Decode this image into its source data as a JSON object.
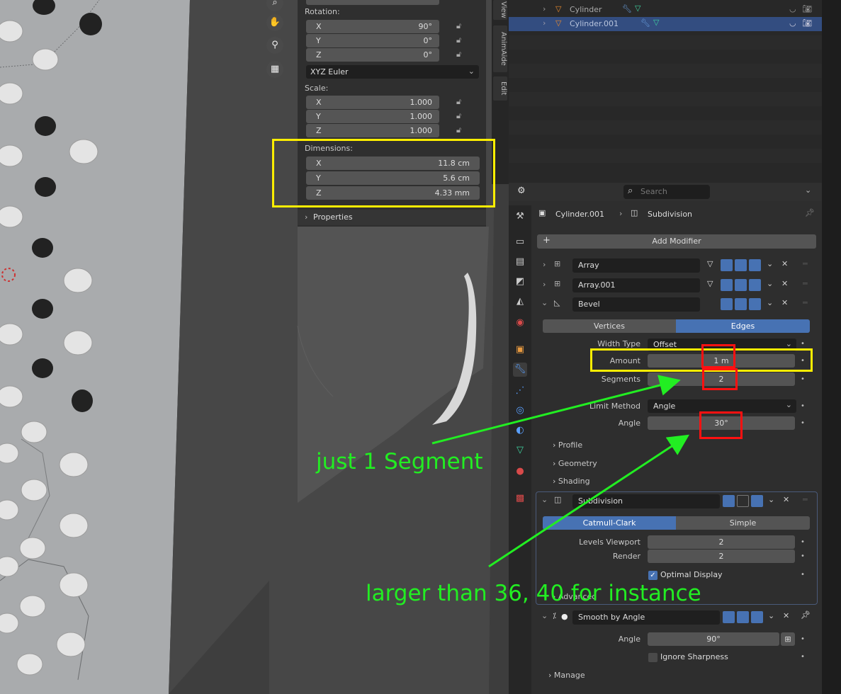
{
  "npanel": {
    "rotation_label": "Rotation:",
    "rotation": [
      {
        "axis": "X",
        "value": "90°"
      },
      {
        "axis": "Y",
        "value": "0°"
      },
      {
        "axis": "Z",
        "value": "0°"
      }
    ],
    "rotation_mode": "XYZ Euler",
    "scale_label": "Scale:",
    "scale": [
      {
        "axis": "X",
        "value": "1.000"
      },
      {
        "axis": "Y",
        "value": "1.000"
      },
      {
        "axis": "Z",
        "value": "1.000"
      }
    ],
    "dimensions_label": "Dimensions:",
    "dimensions": [
      {
        "axis": "X",
        "value": "11.8 cm"
      },
      {
        "axis": "Y",
        "value": "5.6 cm"
      },
      {
        "axis": "Z",
        "value": "4.33 mm"
      }
    ],
    "properties_label": "Properties"
  },
  "vtabs": [
    "View",
    "AnimAide",
    "Edit"
  ],
  "outliner": {
    "rows": [
      {
        "name": "Cylinder",
        "selected": false
      },
      {
        "name": "Cylinder.001",
        "selected": true
      }
    ]
  },
  "props": {
    "search_placeholder": "Search",
    "breadcrumb_object": "Cylinder.001",
    "breadcrumb_modifier": "Subdivision",
    "add_modifier": "Add Modifier",
    "modifiers": {
      "array1": "Array",
      "array2": "Array.001",
      "bevel": "Bevel",
      "subdivision": "Subdivision",
      "smooth": "Smooth by Angle"
    },
    "bevel": {
      "tab_vertices": "Vertices",
      "tab_edges": "Edges",
      "width_type_label": "Width Type",
      "width_type": "Offset",
      "amount_label": "Amount",
      "amount": "1 m",
      "segments_label": "Segments",
      "segments": "2",
      "limit_method_label": "Limit Method",
      "limit_method": "Angle",
      "angle_label": "Angle",
      "angle": "30°",
      "profile": "Profile",
      "geometry": "Geometry",
      "shading": "Shading"
    },
    "subdivision": {
      "tab_catmull": "Catmull-Clark",
      "tab_simple": "Simple",
      "levels_viewport_label": "Levels Viewport",
      "levels_viewport": "2",
      "render_label": "Render",
      "render": "2",
      "optimal_display": "Optimal Display",
      "advanced": "Advanced"
    },
    "smooth": {
      "angle_label": "Angle",
      "angle": "90°",
      "ignore_sharpness": "Ignore Sharpness",
      "manage": "Manage"
    }
  },
  "annotations": {
    "segment_note": "just 1 Segment",
    "angle_note": "larger than 36, 40 for instance",
    "annotation_color": "#22ee22",
    "highlight_color": "#ffee00",
    "marker_color": "#ff1111"
  },
  "colors": {
    "accent_blue": "#4772b3",
    "selected_row": "#334d80"
  }
}
